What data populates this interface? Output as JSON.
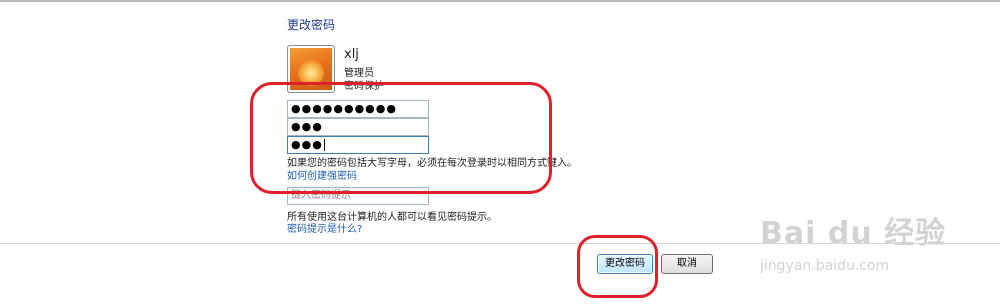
{
  "page": {
    "title": "更改密码"
  },
  "user": {
    "name": "xlj",
    "role": "管理员",
    "status": "密码保护"
  },
  "form": {
    "current_password_mask": "●●●●●●●●●●",
    "new_password_mask": "●●●",
    "confirm_password_mask": "●●●",
    "caps_hint": "如果您的密码包括大写字母，必须在每次登录时以相同方式键入。",
    "create_link": "如何创建强密码",
    "hint_placeholder": "键入密码提示",
    "hint_note": "所有使用这台计算机的人都可以看见密码提示。",
    "hint_link": "密码提示是什么?"
  },
  "buttons": {
    "change": "更改密码",
    "cancel": "取消"
  },
  "watermark": {
    "main": "Bai  du 经验",
    "sub": "jingyan.baidu.com"
  },
  "colors": {
    "annotation": "#e0202a",
    "link": "#1e5fae",
    "title": "#1e3b8c"
  }
}
